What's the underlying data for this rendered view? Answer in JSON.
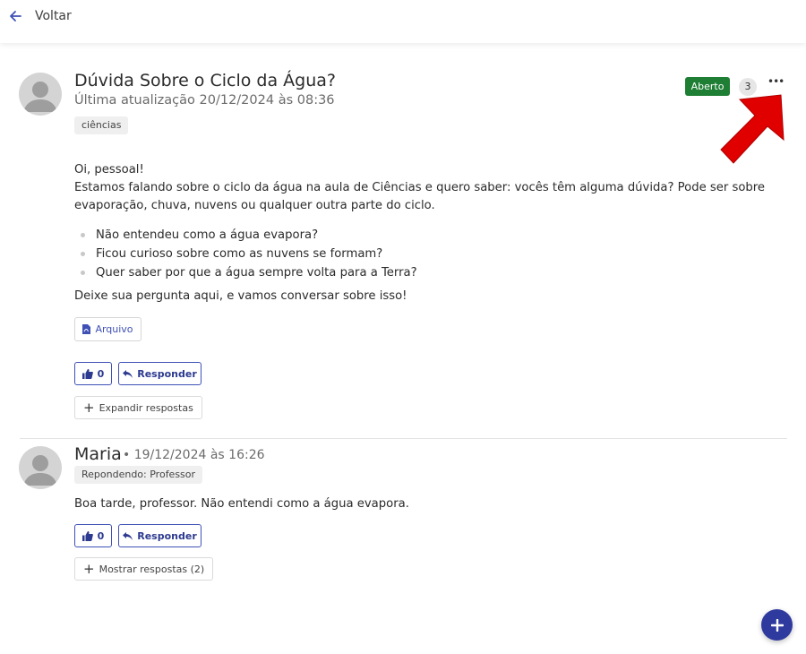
{
  "header": {
    "back_label": "Voltar"
  },
  "post": {
    "title": "Dúvida Sobre o Ciclo da Água?",
    "updated": "Última atualização 20/12/2024 às 08:36",
    "tag": "ciências",
    "status": "Aberto",
    "status_color": "#1e7e34",
    "reply_count": "3",
    "more_label": "•••",
    "greeting": "Oi, pessoal!",
    "paragraph": "Estamos falando sobre o ciclo da água na aula de Ciências e quero saber: vocês têm alguma dúvida? Pode ser sobre evaporação, chuva, nuvens ou qualquer outra parte do ciclo.",
    "bullets": [
      "Não entendeu como a água evapora?",
      "Ficou curioso sobre como as nuvens se formam?",
      "Quer saber por que a água sempre volta para a Terra?"
    ],
    "outro": "Deixe sua pergunta aqui, e vamos conversar sobre isso!",
    "file_label": "Arquivo",
    "likes": "0",
    "reply_label": "Responder",
    "expand_label": "Expandir respostas"
  },
  "comment": {
    "author": "Maria",
    "date": "• 19/12/2024 às 16:26",
    "replying_to": "Repondendo: Professor",
    "text": "Boa tarde, professor. Não entendi como a água evapora.",
    "likes": "0",
    "reply_label": "Responder",
    "show_replies_label": "Mostrar respostas (2)"
  },
  "colors": {
    "accent": "#3f51b5",
    "fab": "#2f3a9e",
    "annotation_arrow": "#e00000"
  }
}
